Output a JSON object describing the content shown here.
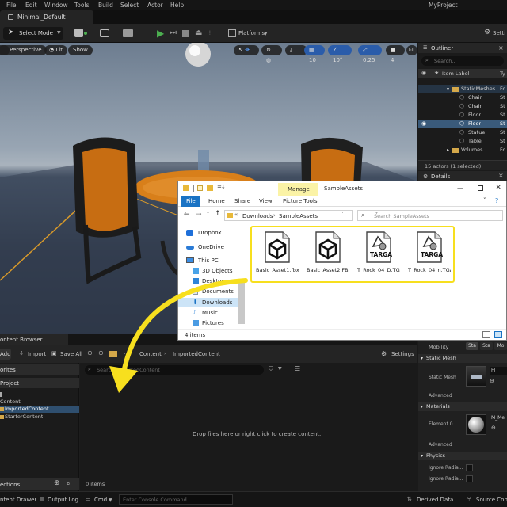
{
  "menu": [
    "File",
    "Edit",
    "Window",
    "Tools",
    "Build",
    "Select",
    "Actor",
    "Help"
  ],
  "project_name": "MyProject",
  "level_tab": "Minimal_Default",
  "toolbar": {
    "select_mode": "Select Mode",
    "platforms": "Platforms",
    "settings": "Setti"
  },
  "viewport": {
    "perspective": "Perspective",
    "lit": "Lit",
    "show": "Show",
    "grid_snap": "10",
    "rot_snap": "10°",
    "scale_snap": "0.25",
    "cam_speed": "4"
  },
  "outliner": {
    "title": "Outliner",
    "search_placeholder": "Search...",
    "col_label": "Item Label",
    "col_type": "Ty",
    "rows": [
      {
        "label": "StaticMeshes",
        "type": "Fo"
      },
      {
        "label": "Chair",
        "type": "St"
      },
      {
        "label": "Chair",
        "type": "St"
      },
      {
        "label": "Floor",
        "type": "St"
      },
      {
        "label": "Floor",
        "type": "St"
      },
      {
        "label": "Statue",
        "type": "St"
      },
      {
        "label": "Table",
        "type": "St"
      },
      {
        "label": "Volumes",
        "type": "Fo"
      }
    ],
    "status": "15 actors (1 selected)"
  },
  "details": {
    "title": "Details"
  },
  "explorer": {
    "manage_tab": "Manage",
    "window_title": "SampleAssets",
    "tabs": [
      "File",
      "Home",
      "Share",
      "View",
      "Picture Tools"
    ],
    "path": [
      "Downloads",
      "SampleAssets"
    ],
    "search_placeholder": "Search SampleAssets",
    "nav": [
      "Dropbox",
      "OneDrive",
      "This PC",
      "3D Objects",
      "Desktop",
      "Documents",
      "Downloads",
      "Music",
      "Pictures"
    ],
    "files": [
      {
        "name": "Basic_Asset1.fbx",
        "kind": "fbx"
      },
      {
        "name": "Basic_Asset2.FBX",
        "kind": "fbx"
      },
      {
        "name": "T_Rock_04_D.TGA",
        "kind": "tga"
      },
      {
        "name": "T_Rock_04_n.TGA",
        "kind": "tga"
      }
    ],
    "targa_label": "TARGA",
    "status": "4 items"
  },
  "content_browser": {
    "tab": "ontent Browser",
    "add": "Add",
    "import": "Import",
    "save_all": "Save All",
    "breadcrumb": [
      "Content",
      "ImportedContent"
    ],
    "settings": "Settings",
    "search_placeholder": "Search ImportedContent",
    "favorites": "orites",
    "project": "Project",
    "tree": [
      "Content",
      "ImportedContent",
      "StarterContent"
    ],
    "empty_msg": "Drop files here or right click to create content.",
    "collections": "ections",
    "items_count": "0 items"
  },
  "details_panel": {
    "mobility": "Mobility",
    "mobility_opts": [
      "Sta",
      "Sta",
      "Mo"
    ],
    "static_mesh_section": "Static Mesh",
    "static_mesh_label": "Static Mesh",
    "static_mesh_value": "Fl",
    "advanced": "Advanced",
    "materials_section": "Materials",
    "element0": "Element 0",
    "material_value": "M_Me",
    "physics_section": "Physics",
    "ignore1": "Ignore Radia...",
    "ignore2": "Ignore Radia..."
  },
  "statusbar": {
    "drawer": "ntent Drawer",
    "output_log": "Output Log",
    "cmd": "Cmd",
    "console_placeholder": "Enter Console Command",
    "derived_data": "Derived Data",
    "source_control": "Source Cont"
  },
  "colors": {
    "accent_yellow": "#f7df1e",
    "play_green": "#4caf50",
    "selection_blue": "#2f4f6f",
    "explorer_tab_blue": "#1a73c4"
  }
}
